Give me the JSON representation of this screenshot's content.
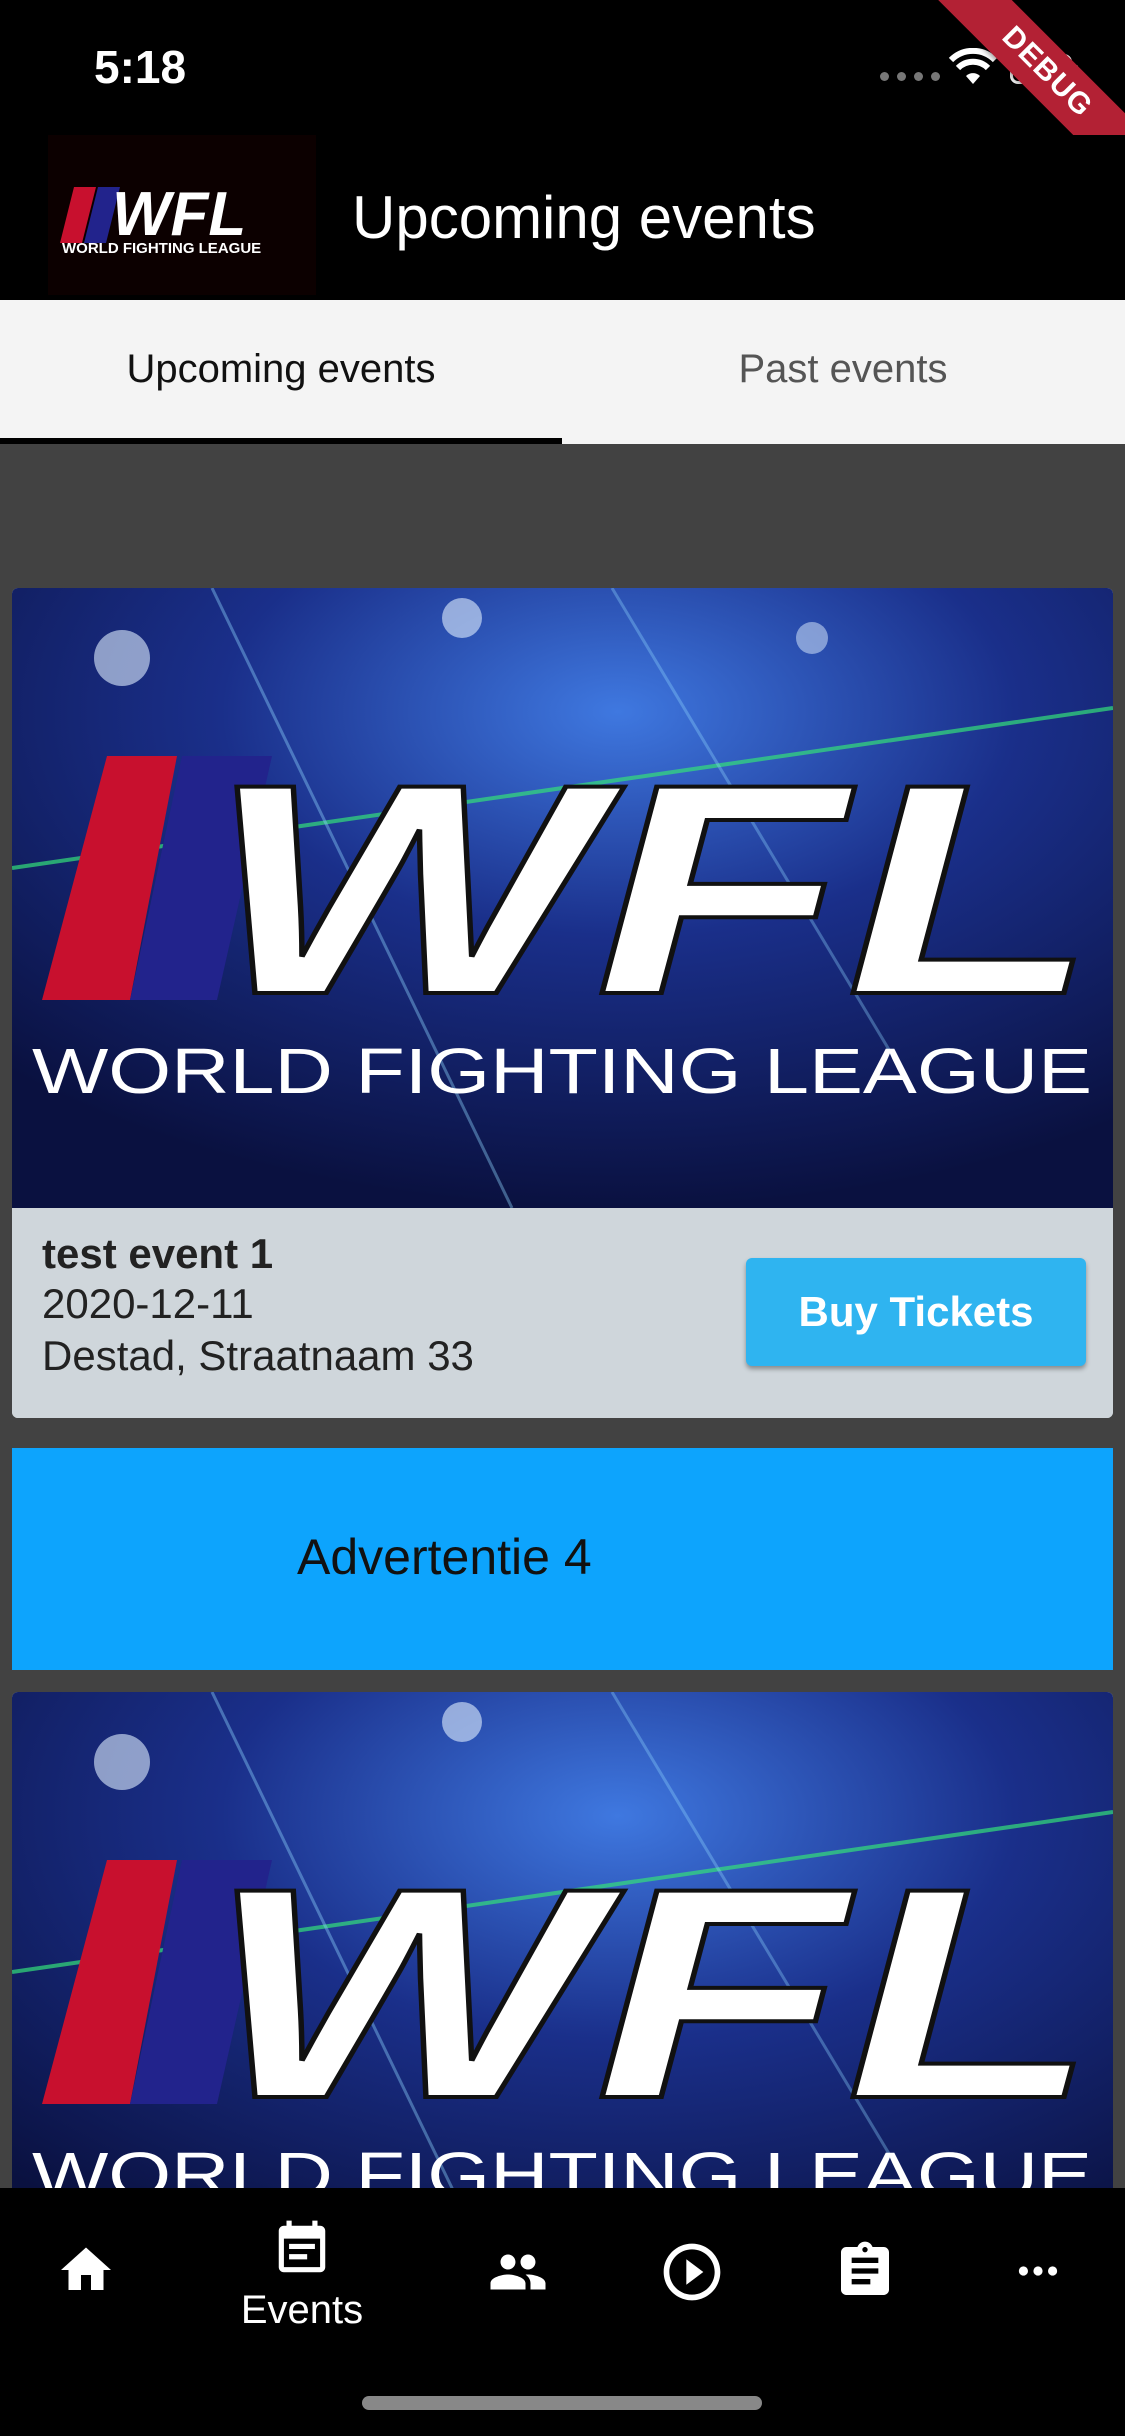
{
  "status_bar": {
    "time": "5:18",
    "debug_label": "DEBUG",
    "battery_level": 0.85
  },
  "app_bar": {
    "title": "Upcoming events",
    "logo_text": "WFL",
    "logo_subtext": "WORLD FIGHTING LEAGUE"
  },
  "tabs": [
    {
      "label": "Upcoming events",
      "selected": true
    },
    {
      "label": "Past events",
      "selected": false
    }
  ],
  "events": [
    {
      "image_logo_text": "WFL",
      "image_subtext": "WORLD FIGHTING LEAGUE",
      "name": "test event 1",
      "date": "2020-12-11",
      "location": "Destad, Straatnaam 33",
      "button_label": "Buy Tickets"
    },
    {
      "image_logo_text": "WFL",
      "image_subtext": "WORLD FIGHTING LEAGUE"
    }
  ],
  "advertisement": {
    "text": "Advertentie 4"
  },
  "bottom_nav": [
    {
      "icon": "home-icon",
      "label": ""
    },
    {
      "icon": "calendar-events-icon",
      "label": "Events",
      "selected": true
    },
    {
      "icon": "people-icon",
      "label": ""
    },
    {
      "icon": "play-circle-icon",
      "label": ""
    },
    {
      "icon": "clipboard-icon",
      "label": ""
    },
    {
      "icon": "more-horizontal-icon",
      "label": ""
    }
  ],
  "colors": {
    "background": "#000000",
    "content_background": "#424242",
    "card_info": "#cfd6db",
    "buy_button": "#2fb4f0",
    "ad_banner": "#0da4fd",
    "logo_red": "#c8102e",
    "logo_blue": "#22238c",
    "debug_ribbon": "#b32134"
  }
}
